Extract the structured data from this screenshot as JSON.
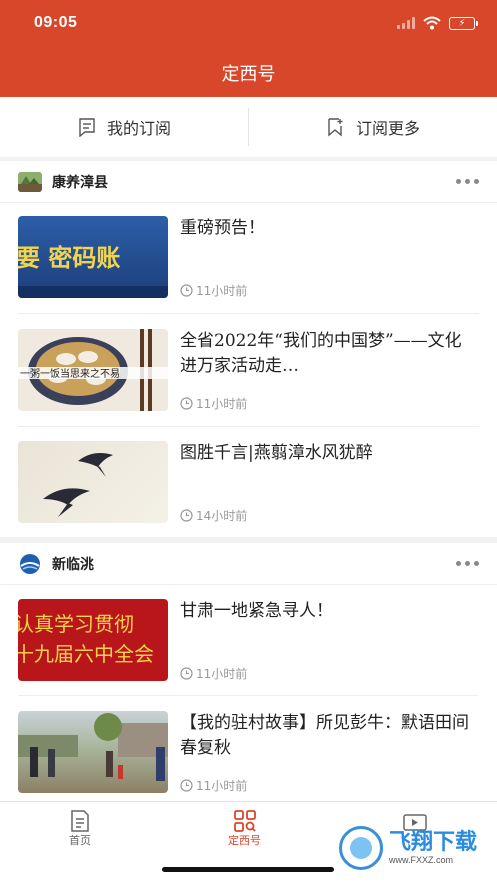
{
  "status_bar": {
    "time": "09:05"
  },
  "header": {
    "title": "定西号"
  },
  "subscribe_bar": {
    "my_subscriptions": "我的订阅",
    "subscribe_more": "订阅更多"
  },
  "sources": [
    {
      "name": "康养漳县",
      "items": [
        {
          "title": "重磅预告！",
          "time": "11小时前",
          "thumb_text": "要  密码账"
        },
        {
          "title": "全省2022年“我们的中国梦”——文化进万家活动走…",
          "time": "11小时前",
          "thumb_text": "一粥一饭当思来之不易"
        },
        {
          "title": "图胜千言|燕翦漳水风犹醉",
          "time": "14小时前"
        }
      ]
    },
    {
      "name": "新临洮",
      "items": [
        {
          "title": "甘肃一地紧急寻人！",
          "time": "11小时前",
          "thumb_text_1": "认真学习贯彻",
          "thumb_text_2": "十九届六中全会"
        },
        {
          "title": "【我的驻村故事】所见彭牛：默语田间春复秋",
          "time": "11小时前"
        }
      ]
    }
  ],
  "tabbar": {
    "home": "首页",
    "dingxi": "定西号"
  },
  "watermark": {
    "text": "飞翔下载",
    "url": "www.FXXZ.com"
  },
  "colors": {
    "brand": "#d9472b",
    "text_muted": "#999999"
  }
}
